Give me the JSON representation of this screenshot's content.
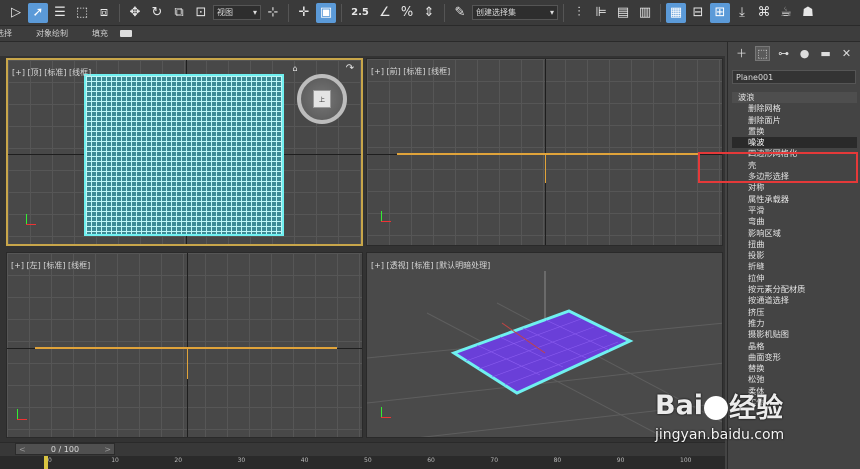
{
  "toolbar": {
    "view_dropdown": "视图",
    "selection_set_dropdown": "创建选择集",
    "snap_label": "2.5"
  },
  "ribbon": {
    "items": [
      "选择",
      "对象绘制",
      "填充"
    ]
  },
  "viewports": {
    "top": {
      "label": "[+] [顶] [标准] [线框]"
    },
    "front": {
      "label": "[+] [前] [标准] [线框]"
    },
    "left": {
      "label": "[+] [左] [标准] [线框]"
    },
    "perspective": {
      "label": "[+] [透视] [标准] [默认明暗处理]"
    },
    "viewcube_face": "上"
  },
  "command_panel": {
    "object_name": "Plane001",
    "modifier_header": "波浪",
    "modifiers": [
      "删除网格",
      "删除面片",
      "置换",
      "噪波",
      "四边形网格化",
      "壳",
      "多边形选择",
      "对称",
      "属性承载器",
      "平滑",
      "弯曲",
      "影响区域",
      "扭曲",
      "投影",
      "折缝",
      "拉伸",
      "按元素分配材质",
      "按通道选择",
      "挤压",
      "推力",
      "摄影机贴图",
      "晶格",
      "曲面变形",
      "替换",
      "松弛",
      "柔体",
      "实体"
    ],
    "selected_modifier": "噪波"
  },
  "timeline": {
    "slider_text": "0 / 100",
    "ticks": [
      "0",
      "10",
      "20",
      "30",
      "40",
      "50",
      "60",
      "70",
      "80",
      "90",
      "100"
    ]
  },
  "watermark": {
    "logo_left": "Bai",
    "logo_right": "经验",
    "url": "jingyan.baidu.com"
  },
  "colors": {
    "active_viewport_border": "#c8a64a",
    "mesh_wire": "#6ff0f0",
    "plane_fill": "#6a3fd8",
    "highlight": "#e53939"
  }
}
